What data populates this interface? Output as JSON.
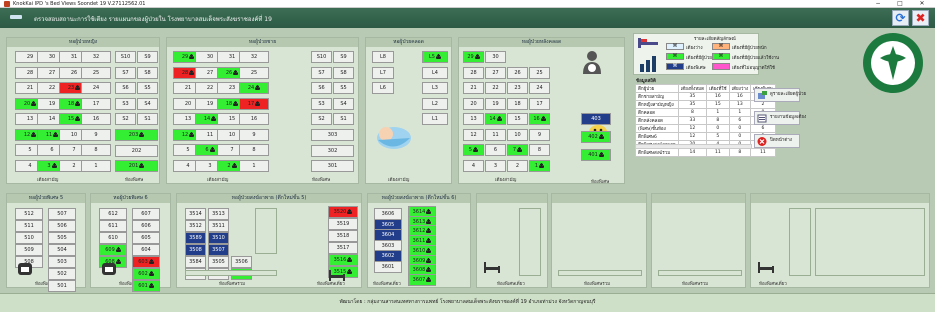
{
  "window": {
    "title": "KnokKai IPD 's Bed Views Soondet 19 V.27112562.01",
    "minimize": "−",
    "maximize": "□",
    "close": "✕"
  },
  "header": {
    "title": "ตรวจสอบสถานะการใช้เตียง รายแผนกของผู้ป่วยใน โรงพยาบาลสมเด็จพระสังฆราชองค์ที่ 19"
  },
  "colors": {
    "occupied": "#33ee33",
    "alert": "#ee2222",
    "special": "#223e8a",
    "empty": "#eef0ee",
    "header": "#2c5a45"
  },
  "wards": {
    "female": {
      "title": "หอผู้ป่วยหญิง",
      "foot_main": "เตียงสามัญ",
      "foot_room": "ห้องพิเศษ",
      "beds": [
        [
          "29",
          "30",
          "31",
          "32"
        ],
        [
          "28",
          "27",
          "26",
          "25"
        ],
        [
          "21",
          "22",
          "23",
          "24"
        ],
        [
          "20",
          "19",
          "18",
          "17"
        ],
        [
          "13",
          "14",
          "15",
          "16"
        ],
        [
          "12",
          "11",
          "10",
          "9"
        ],
        [
          "5",
          "6",
          "7",
          "8"
        ],
        [
          "4",
          "3",
          "2",
          "1"
        ]
      ],
      "rooms": [
        [
          "S10",
          "S9"
        ],
        [
          "S7",
          "S8"
        ],
        [
          "S6",
          "S5"
        ],
        [
          "S3",
          "S4"
        ],
        [
          "S2",
          "S1"
        ]
      ],
      "rooms2": [
        "203",
        "202",
        "201"
      ]
    },
    "male": {
      "title": "หอผู้ป่วยชาย",
      "foot_main": "เตียงสามัญ",
      "foot_room": "ห้องพิเศษ",
      "beds": [
        [
          "29",
          "30",
          "31",
          "32"
        ],
        [
          "28",
          "27",
          "26",
          "25"
        ],
        [
          "21",
          "22",
          "23",
          "24"
        ],
        [
          "20",
          "19",
          "18",
          "17"
        ],
        [
          "13",
          "14",
          "15",
          "16"
        ],
        [
          "12",
          "11",
          "10",
          "9"
        ],
        [
          "5",
          "6",
          "7",
          "8"
        ],
        [
          "4",
          "3",
          "2",
          "1"
        ]
      ],
      "rooms": [
        [
          "S10",
          "S9"
        ],
        [
          "S7",
          "S8"
        ],
        [
          "S6",
          "S5"
        ],
        [
          "S3",
          "S4"
        ],
        [
          "S2",
          "S1"
        ]
      ],
      "rooms2": [
        "303",
        "302",
        "301"
      ]
    },
    "labor": {
      "title": "หอผู้ป่วยคลอด",
      "foot": "เตียงสามัญ",
      "left": [
        "L8",
        "L7",
        "L6"
      ],
      "right": [
        "L5",
        "L4",
        "L3",
        "L2",
        "L1"
      ]
    },
    "postpartum": {
      "title": "หอผู้ป่วยหลังคลอด",
      "foot_main": "เตียงสามัญ",
      "foot_room": "ห้องพิเศษ",
      "beds": [
        [
          "29",
          "30"
        ],
        [
          "28",
          "27",
          "26",
          "25"
        ],
        [
          "21",
          "22",
          "23",
          "24"
        ],
        [
          "20",
          "19",
          "18",
          "17"
        ],
        [
          "13",
          "14",
          "15",
          "16"
        ],
        [
          "12",
          "11",
          "10",
          "9"
        ],
        [
          "5",
          "6",
          "7",
          "8"
        ],
        [
          "4",
          "3",
          "2",
          "1"
        ]
      ],
      "rooms": [
        "403",
        "402",
        "401"
      ]
    },
    "special5": {
      "title": "หอผู้ป่วยพิเศษ 5",
      "foot": "ห้องพิเศษ",
      "beds": [
        [
          "512",
          "507"
        ],
        [
          "511",
          "506"
        ],
        [
          "510",
          "505"
        ],
        [
          "509",
          "504"
        ],
        [
          "508",
          "503"
        ],
        [
          "",
          "502"
        ],
        [
          "",
          "501"
        ]
      ]
    },
    "special6": {
      "title": "หอผู้ป่วยพิเศษ 6",
      "foot": "ห้องพิเศษ",
      "beds": [
        [
          "612",
          "607"
        ],
        [
          "611",
          "606"
        ],
        [
          "610",
          "605"
        ],
        [
          "609",
          "604"
        ],
        [
          "608",
          "603"
        ],
        [
          "",
          "602"
        ],
        [
          "",
          "601"
        ]
      ]
    },
    "monk5": {
      "title": "หอผู้ป่วยสงฆ์อาพาธ (ตึกใหม่ชั้น 5)",
      "foot": "ห้องพิเศษรวม",
      "foot2": "ห้องพิเศษเดี่ยว",
      "beds": [
        [
          "3514",
          "3513"
        ],
        [
          "3512",
          "3511"
        ],
        [
          "3589",
          "3510"
        ],
        [
          "3508",
          "3507"
        ],
        [
          "3584",
          "3505",
          "3506"
        ],
        [
          "3583",
          "3502",
          "3501"
        ]
      ],
      "single": [
        "3520",
        "3519",
        "3518",
        "3517",
        "3516",
        "3515"
      ]
    },
    "monk6": {
      "title": "หอผู้ป่วยสงฆ์อาพาธ (ตึกใหม่ชั้น 6)",
      "foot": "ห้องพิเศษเดี่ยว",
      "left": [
        "3606",
        "3605",
        "3604",
        "3603",
        "3602",
        "3601"
      ],
      "right": [
        "3614",
        "3613",
        "3612",
        "3611",
        "3610",
        "3609",
        "3608",
        "3607"
      ]
    },
    "empty1": {
      "foot": "ห้องพิเศษเดี่ยว"
    },
    "empty2": {
      "foot": "ห้องพิเศษรวม"
    },
    "empty3": {
      "foot": "ห้องพิเศษรวม"
    },
    "empty4": {
      "foot": "ห้องพิเศษเดี่ยว"
    }
  },
  "legend": {
    "title": "รายละเอียดสัญลักษณ์",
    "items": [
      {
        "label": "เตียงว่าง",
        "color": "#eef0ee"
      },
      {
        "label": "เตียงที่มีผู้ป่วยแล้ว",
        "color": "#33ee33"
      },
      {
        "label": "เตียงพิเศษ",
        "color": "#223e8a"
      },
      {
        "label": "เตียงที่มีผู้ป่วยหนัก",
        "color": "#ee2222"
      },
      {
        "label": "เตียงที่มีผู้ป่วยแล้วใช้งาน",
        "color": "#33ee33"
      },
      {
        "label": "เตียงที่ไม่อนุญาตให้ใช้",
        "color": "#ff55cc"
      }
    ]
  },
  "stats": {
    "title": "ข้อมูลสถิติ",
    "headers": [
      "ตึกผู้ป่วย",
      "เตียงทั้งหมด",
      "เตียงที่ใช้",
      "เตียงว่าง",
      "เตียงพิเศษ"
    ],
    "rows": [
      [
        "ตึกชายสามัญ",
        "35",
        "16",
        "16",
        "0"
      ],
      [
        "ตึกหญิงสามัญหญิง",
        "35",
        "15",
        "13",
        "2"
      ],
      [
        "ตึกคลอด",
        "8",
        "1",
        "1",
        "0"
      ],
      [
        "ตึกหลังคลอด",
        "33",
        "8",
        "6",
        "2"
      ],
      [
        "(พิเศษ)ชั้นห้อง",
        "12",
        "0",
        "0",
        "6"
      ],
      [
        "ตึกพิเศษ6",
        "12",
        "5",
        "0",
        "5"
      ],
      [
        "ตึกพิเศษสงฆ์อาพาธ",
        "20",
        "4",
        "0",
        "4"
      ],
      [
        "ตึกพิเศษสงฆ์รวม",
        "14",
        "11",
        "8",
        "11"
      ]
    ]
  },
  "buttons": {
    "detail": "ดูรายละเอียดผู้ป่วย",
    "report": "รายงานข้อมูลเตียง",
    "exit": "ปิดหน้าต่าง"
  },
  "footer": {
    "text": "พัฒนาโดย : กลุ่มงานสารสนเทศทางการแพทย์ โรงพยาบาลสมเด็จพระสังฆราชองค์ที่ 19 อำเภอท่าม่วง จังหวัดกาญจนบุรี"
  }
}
